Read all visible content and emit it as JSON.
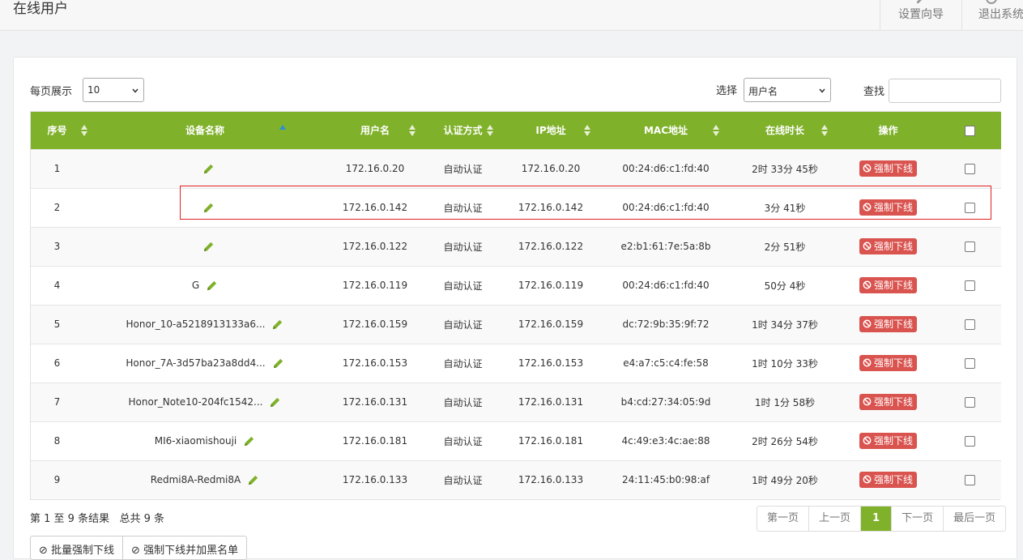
{
  "header": {
    "title": "在线用户",
    "setup_wizard": "设置向导",
    "exit_system": "退出系统"
  },
  "controls": {
    "per_page_label": "每页展示",
    "per_page_value": "10",
    "choose_label": "选择",
    "choose_value": "用户名",
    "search_label": "查找",
    "search_value": ""
  },
  "table": {
    "columns": [
      "序号",
      "设备名称",
      "用户名",
      "认证方式",
      "IP地址",
      "MAC地址",
      "在线时长",
      "操作"
    ],
    "kick_label": "强制下线",
    "rows": [
      {
        "no": "1",
        "device": "",
        "user": "172.16.0.20",
        "auth": "自动认证",
        "ip": "172.16.0.20",
        "mac": "00:24:d6:c1:fd:40",
        "duration": "2时 33分 45秒"
      },
      {
        "no": "2",
        "device": "",
        "user": "172.16.0.142",
        "auth": "自动认证",
        "ip": "172.16.0.142",
        "mac": "00:24:d6:c1:fd:40",
        "duration": "3分 41秒"
      },
      {
        "no": "3",
        "device": "",
        "user": "172.16.0.122",
        "auth": "自动认证",
        "ip": "172.16.0.122",
        "mac": "e2:b1:61:7e:5a:8b",
        "duration": "2分 51秒"
      },
      {
        "no": "4",
        "device": "G",
        "user": "172.16.0.119",
        "auth": "自动认证",
        "ip": "172.16.0.119",
        "mac": "00:24:d6:c1:fd:40",
        "duration": "50分 4秒"
      },
      {
        "no": "5",
        "device": "Honor_10-a5218913133a6...",
        "user": "172.16.0.159",
        "auth": "自动认证",
        "ip": "172.16.0.159",
        "mac": "dc:72:9b:35:9f:72",
        "duration": "1时 34分 37秒"
      },
      {
        "no": "6",
        "device": "Honor_7A-3d57ba23a8dd4...",
        "user": "172.16.0.153",
        "auth": "自动认证",
        "ip": "172.16.0.153",
        "mac": "e4:a7:c5:c4:fe:58",
        "duration": "1时 10分 33秒"
      },
      {
        "no": "7",
        "device": "Honor_Note10-204fc1542...",
        "user": "172.16.0.131",
        "auth": "自动认证",
        "ip": "172.16.0.131",
        "mac": "b4:cd:27:34:05:9d",
        "duration": "1时 1分 58秒"
      },
      {
        "no": "8",
        "device": "MI6-xiaomishouji",
        "user": "172.16.0.181",
        "auth": "自动认证",
        "ip": "172.16.0.181",
        "mac": "4c:49:e3:4c:ae:88",
        "duration": "2时 26分 54秒"
      },
      {
        "no": "9",
        "device": "Redmi8A-Redmi8A",
        "user": "172.16.0.133",
        "auth": "自动认证",
        "ip": "172.16.0.133",
        "mac": "24:11:45:b0:98:af",
        "duration": "1时 49分 20秒"
      }
    ]
  },
  "footer": {
    "summary": "第 1 至 9 条结果   总共 9 条",
    "pager": {
      "first": "第一页",
      "prev": "上一页",
      "current": "1",
      "next": "下一页",
      "last": "最后一页"
    },
    "batch_kick": "批量强制下线",
    "kick_and_block": "强制下线并加黑名单"
  },
  "colors": {
    "accent": "#7fb12a",
    "danger": "#d9534f",
    "highlight": "#e02020"
  }
}
